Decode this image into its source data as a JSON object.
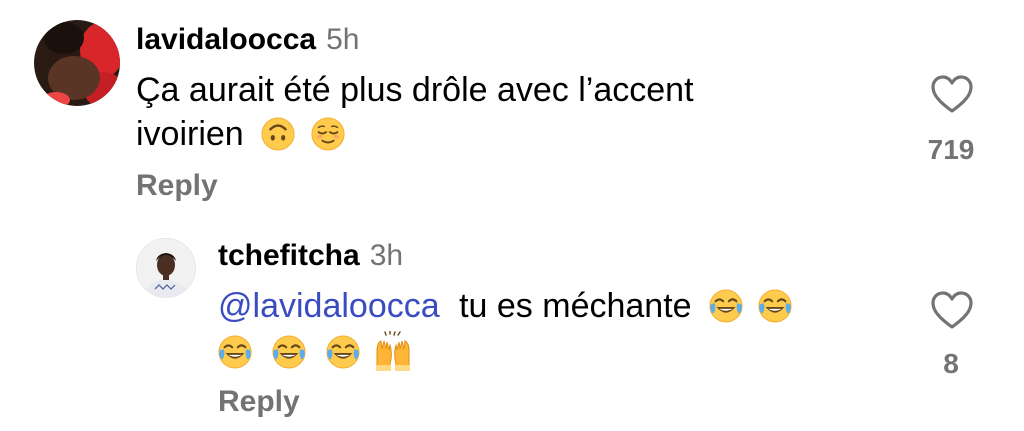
{
  "comment": {
    "username": "lavidaloocca",
    "time": "5h",
    "text_line1": "Ça aurait été  plus drôle avec l’accent",
    "text_line2": "ivoirien",
    "emojis": [
      "upside-down-face",
      "relieved-face"
    ],
    "reply_label": "Reply",
    "like_count": "719"
  },
  "reply": {
    "username": "tchefitcha",
    "time": "3h",
    "mention": "@lavidaloocca",
    "text_line1": "tu es méchante",
    "emojis_line1": [
      "face-with-tears-of-joy",
      "face-with-tears-of-joy"
    ],
    "emojis_line2": [
      "face-with-tears-of-joy",
      "face-with-tears-of-joy",
      "face-with-tears-of-joy",
      "raising-hands"
    ],
    "reply_label": "Reply",
    "like_count": "8"
  }
}
